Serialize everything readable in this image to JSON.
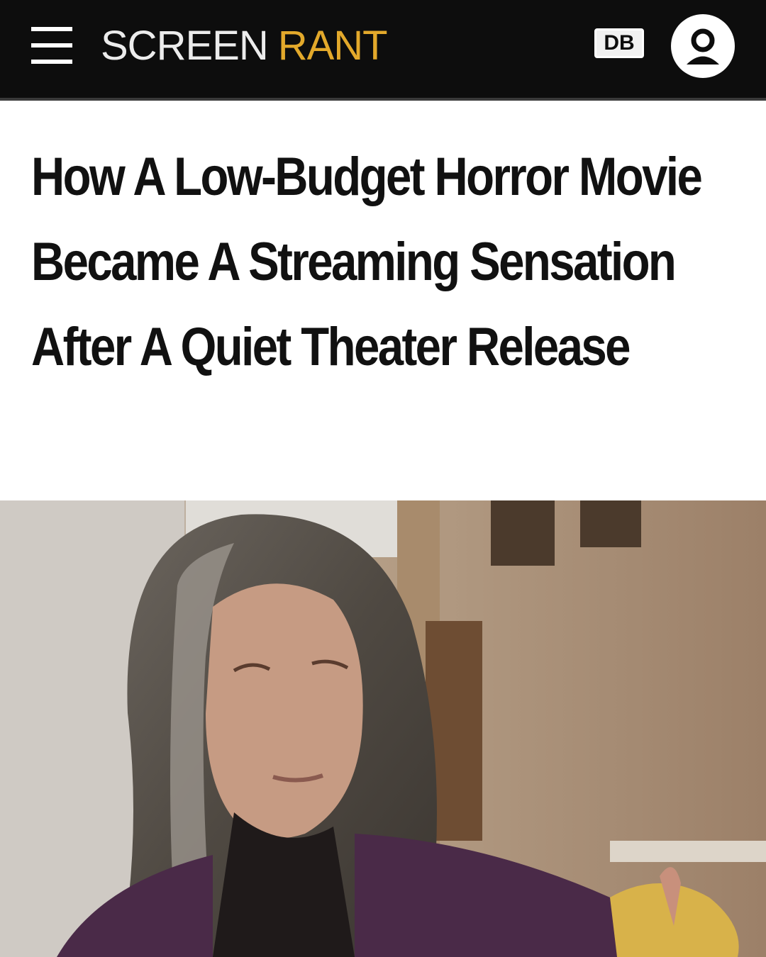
{
  "header": {
    "logo_part1": "SCREEN",
    "logo_part2": "RANT",
    "badge": "DB",
    "menu_icon": "hamburger-menu-icon",
    "account_icon": "user-account-icon",
    "colors": {
      "background": "#0d0d0d",
      "logo_accent": "#e3a92b",
      "logo_main": "#ececec"
    }
  },
  "article": {
    "headline": "How A Low-Budget Horror Movie Became A Streaming Sensation After A Quiet Theater Release"
  }
}
